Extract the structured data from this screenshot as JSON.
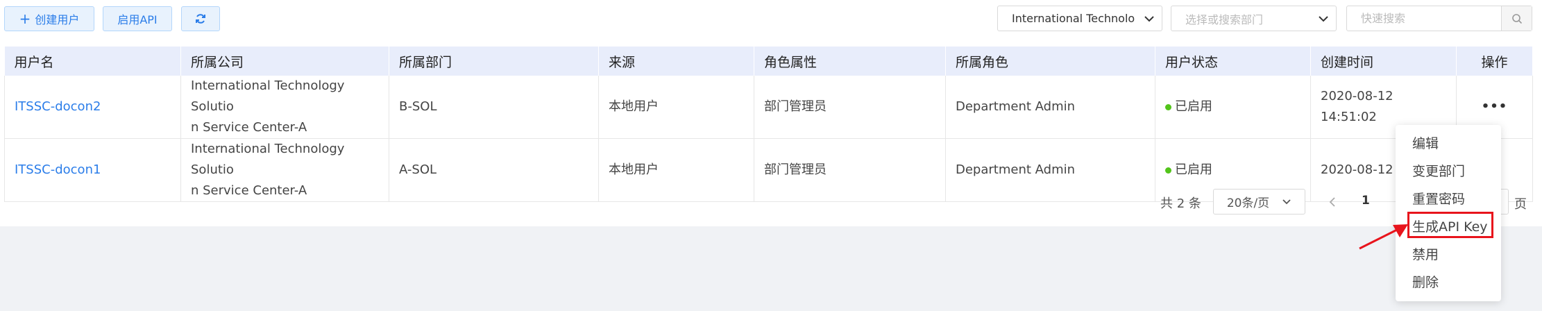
{
  "toolbar": {
    "create_user_label": "创建用户",
    "enable_api_label": "启用API"
  },
  "filters": {
    "company_value": "International Technolo",
    "department_placeholder": "选择或搜索部门",
    "search_placeholder": "快速搜索"
  },
  "table": {
    "columns": [
      "用户名",
      "所属公司",
      "所属部门",
      "来源",
      "角色属性",
      "所属角色",
      "用户状态",
      "创建时间",
      "操作"
    ],
    "rows": [
      {
        "username": "ITSSC-docon2",
        "company_line1": "International Technology Solutio",
        "company_line2": "n Service Center-A",
        "department": "B-SOL",
        "source": "本地用户",
        "role_attr": "部门管理员",
        "role": "Department Admin",
        "status": "已启用",
        "created": "2020-08-12 14:51:02",
        "action": "•••"
      },
      {
        "username": "ITSSC-docon1",
        "company_line1": "International Technology Solutio",
        "company_line2": "n Service Center-A",
        "department": "A-SOL",
        "source": "本地用户",
        "role_attr": "部门管理员",
        "role": "Department Admin",
        "status": "已启用",
        "created": "2020-08-12 1",
        "action": ""
      }
    ]
  },
  "pagination": {
    "total": "共 2 条",
    "page_size": "20条/页",
    "current_page": "1",
    "page_unit": "页"
  },
  "action_menu": {
    "items": [
      "编辑",
      "变更部门",
      "重置密码",
      "生成API Key",
      "禁用",
      "删除"
    ],
    "highlighted": "生成API Key"
  },
  "colors": {
    "accent": "#2b7de9",
    "header_bg": "#e8edfb",
    "status_enabled": "#52c41a",
    "highlight_red": "#e8141c"
  },
  "icons": [
    "plus-icon",
    "refresh-icon",
    "chevron-down-icon",
    "search-icon",
    "chevron-left-icon",
    "arrow-icon"
  ]
}
